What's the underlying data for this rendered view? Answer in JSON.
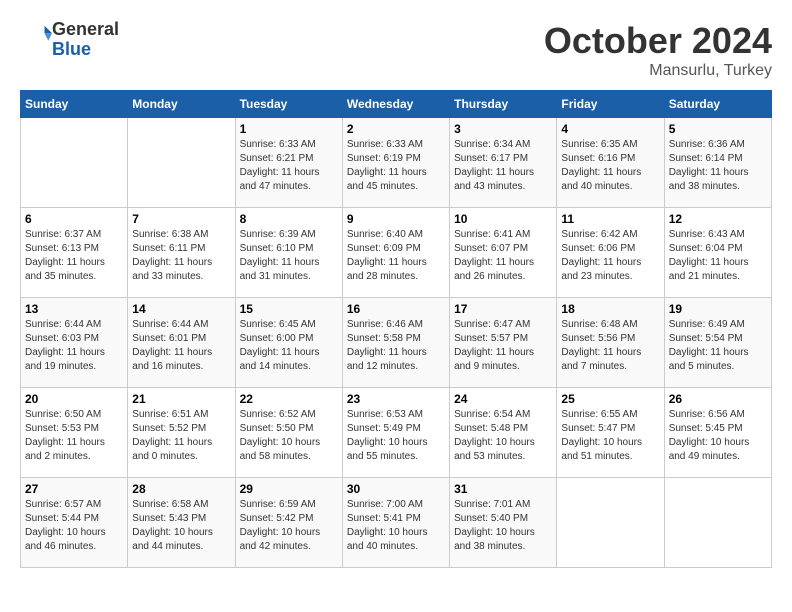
{
  "header": {
    "logo_line1": "General",
    "logo_line2": "Blue",
    "month": "October 2024",
    "location": "Mansurlu, Turkey"
  },
  "weekdays": [
    "Sunday",
    "Monday",
    "Tuesday",
    "Wednesday",
    "Thursday",
    "Friday",
    "Saturday"
  ],
  "weeks": [
    [
      {
        "day": "",
        "sunrise": "",
        "sunset": "",
        "daylight": ""
      },
      {
        "day": "",
        "sunrise": "",
        "sunset": "",
        "daylight": ""
      },
      {
        "day": "1",
        "sunrise": "Sunrise: 6:33 AM",
        "sunset": "Sunset: 6:21 PM",
        "daylight": "Daylight: 11 hours and 47 minutes."
      },
      {
        "day": "2",
        "sunrise": "Sunrise: 6:33 AM",
        "sunset": "Sunset: 6:19 PM",
        "daylight": "Daylight: 11 hours and 45 minutes."
      },
      {
        "day": "3",
        "sunrise": "Sunrise: 6:34 AM",
        "sunset": "Sunset: 6:17 PM",
        "daylight": "Daylight: 11 hours and 43 minutes."
      },
      {
        "day": "4",
        "sunrise": "Sunrise: 6:35 AM",
        "sunset": "Sunset: 6:16 PM",
        "daylight": "Daylight: 11 hours and 40 minutes."
      },
      {
        "day": "5",
        "sunrise": "Sunrise: 6:36 AM",
        "sunset": "Sunset: 6:14 PM",
        "daylight": "Daylight: 11 hours and 38 minutes."
      }
    ],
    [
      {
        "day": "6",
        "sunrise": "Sunrise: 6:37 AM",
        "sunset": "Sunset: 6:13 PM",
        "daylight": "Daylight: 11 hours and 35 minutes."
      },
      {
        "day": "7",
        "sunrise": "Sunrise: 6:38 AM",
        "sunset": "Sunset: 6:11 PM",
        "daylight": "Daylight: 11 hours and 33 minutes."
      },
      {
        "day": "8",
        "sunrise": "Sunrise: 6:39 AM",
        "sunset": "Sunset: 6:10 PM",
        "daylight": "Daylight: 11 hours and 31 minutes."
      },
      {
        "day": "9",
        "sunrise": "Sunrise: 6:40 AM",
        "sunset": "Sunset: 6:09 PM",
        "daylight": "Daylight: 11 hours and 28 minutes."
      },
      {
        "day": "10",
        "sunrise": "Sunrise: 6:41 AM",
        "sunset": "Sunset: 6:07 PM",
        "daylight": "Daylight: 11 hours and 26 minutes."
      },
      {
        "day": "11",
        "sunrise": "Sunrise: 6:42 AM",
        "sunset": "Sunset: 6:06 PM",
        "daylight": "Daylight: 11 hours and 23 minutes."
      },
      {
        "day": "12",
        "sunrise": "Sunrise: 6:43 AM",
        "sunset": "Sunset: 6:04 PM",
        "daylight": "Daylight: 11 hours and 21 minutes."
      }
    ],
    [
      {
        "day": "13",
        "sunrise": "Sunrise: 6:44 AM",
        "sunset": "Sunset: 6:03 PM",
        "daylight": "Daylight: 11 hours and 19 minutes."
      },
      {
        "day": "14",
        "sunrise": "Sunrise: 6:44 AM",
        "sunset": "Sunset: 6:01 PM",
        "daylight": "Daylight: 11 hours and 16 minutes."
      },
      {
        "day": "15",
        "sunrise": "Sunrise: 6:45 AM",
        "sunset": "Sunset: 6:00 PM",
        "daylight": "Daylight: 11 hours and 14 minutes."
      },
      {
        "day": "16",
        "sunrise": "Sunrise: 6:46 AM",
        "sunset": "Sunset: 5:58 PM",
        "daylight": "Daylight: 11 hours and 12 minutes."
      },
      {
        "day": "17",
        "sunrise": "Sunrise: 6:47 AM",
        "sunset": "Sunset: 5:57 PM",
        "daylight": "Daylight: 11 hours and 9 minutes."
      },
      {
        "day": "18",
        "sunrise": "Sunrise: 6:48 AM",
        "sunset": "Sunset: 5:56 PM",
        "daylight": "Daylight: 11 hours and 7 minutes."
      },
      {
        "day": "19",
        "sunrise": "Sunrise: 6:49 AM",
        "sunset": "Sunset: 5:54 PM",
        "daylight": "Daylight: 11 hours and 5 minutes."
      }
    ],
    [
      {
        "day": "20",
        "sunrise": "Sunrise: 6:50 AM",
        "sunset": "Sunset: 5:53 PM",
        "daylight": "Daylight: 11 hours and 2 minutes."
      },
      {
        "day": "21",
        "sunrise": "Sunrise: 6:51 AM",
        "sunset": "Sunset: 5:52 PM",
        "daylight": "Daylight: 11 hours and 0 minutes."
      },
      {
        "day": "22",
        "sunrise": "Sunrise: 6:52 AM",
        "sunset": "Sunset: 5:50 PM",
        "daylight": "Daylight: 10 hours and 58 minutes."
      },
      {
        "day": "23",
        "sunrise": "Sunrise: 6:53 AM",
        "sunset": "Sunset: 5:49 PM",
        "daylight": "Daylight: 10 hours and 55 minutes."
      },
      {
        "day": "24",
        "sunrise": "Sunrise: 6:54 AM",
        "sunset": "Sunset: 5:48 PM",
        "daylight": "Daylight: 10 hours and 53 minutes."
      },
      {
        "day": "25",
        "sunrise": "Sunrise: 6:55 AM",
        "sunset": "Sunset: 5:47 PM",
        "daylight": "Daylight: 10 hours and 51 minutes."
      },
      {
        "day": "26",
        "sunrise": "Sunrise: 6:56 AM",
        "sunset": "Sunset: 5:45 PM",
        "daylight": "Daylight: 10 hours and 49 minutes."
      }
    ],
    [
      {
        "day": "27",
        "sunrise": "Sunrise: 6:57 AM",
        "sunset": "Sunset: 5:44 PM",
        "daylight": "Daylight: 10 hours and 46 minutes."
      },
      {
        "day": "28",
        "sunrise": "Sunrise: 6:58 AM",
        "sunset": "Sunset: 5:43 PM",
        "daylight": "Daylight: 10 hours and 44 minutes."
      },
      {
        "day": "29",
        "sunrise": "Sunrise: 6:59 AM",
        "sunset": "Sunset: 5:42 PM",
        "daylight": "Daylight: 10 hours and 42 minutes."
      },
      {
        "day": "30",
        "sunrise": "Sunrise: 7:00 AM",
        "sunset": "Sunset: 5:41 PM",
        "daylight": "Daylight: 10 hours and 40 minutes."
      },
      {
        "day": "31",
        "sunrise": "Sunrise: 7:01 AM",
        "sunset": "Sunset: 5:40 PM",
        "daylight": "Daylight: 10 hours and 38 minutes."
      },
      {
        "day": "",
        "sunrise": "",
        "sunset": "",
        "daylight": ""
      },
      {
        "day": "",
        "sunrise": "",
        "sunset": "",
        "daylight": ""
      }
    ]
  ]
}
